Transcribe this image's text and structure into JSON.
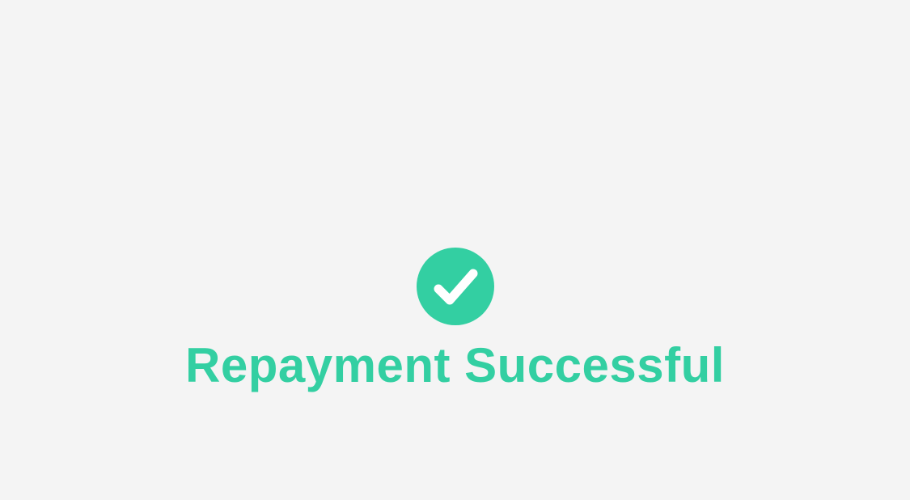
{
  "status": {
    "icon": "check-circle-icon",
    "message": "Repayment Successful"
  },
  "colors": {
    "background": "#f4f4f4",
    "accent": "#33cfa2",
    "icon_mark": "#ffffff"
  }
}
